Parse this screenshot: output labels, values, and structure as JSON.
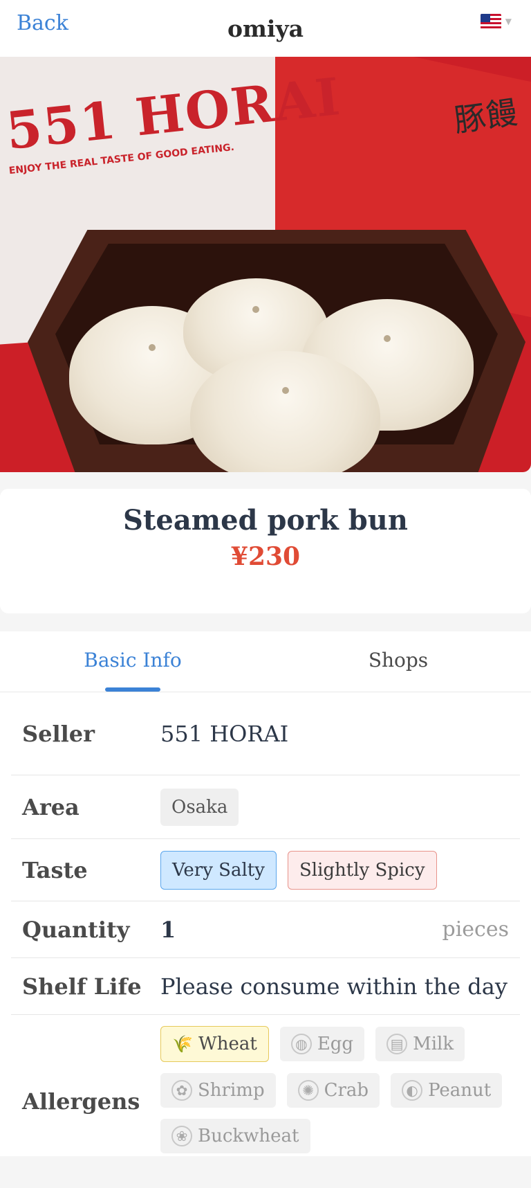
{
  "nav": {
    "back_label": "Back",
    "title": "omiya",
    "language_icon": "us-flag-icon"
  },
  "hero": {
    "brand_text": "551 HORAI",
    "brand_tagline": "ENJOY THE REAL TASTE OF GOOD EATING.",
    "box_kanji": "豚饅"
  },
  "product": {
    "name": "Steamed pork bun",
    "price": "¥230"
  },
  "tabs": [
    {
      "label": "Basic Info",
      "active": true
    },
    {
      "label": "Shops",
      "active": false
    }
  ],
  "details": {
    "seller": {
      "label": "Seller",
      "value": "551 HORAI"
    },
    "area": {
      "label": "Area",
      "value": "Osaka"
    },
    "taste": {
      "label": "Taste",
      "tags": [
        "Very Salty",
        "Slightly Spicy"
      ]
    },
    "quantity": {
      "label": "Quantity",
      "value": "1",
      "unit": "pieces"
    },
    "shelf_life": {
      "label": "Shelf Life",
      "value": "Please consume within the day"
    },
    "allergens": {
      "label": "Allergens",
      "items": [
        {
          "name": "Wheat",
          "icon": "wheat-icon",
          "active": true
        },
        {
          "name": "Egg",
          "icon": "egg-icon",
          "active": false
        },
        {
          "name": "Milk",
          "icon": "milk-icon",
          "active": false
        },
        {
          "name": "Shrimp",
          "icon": "shrimp-icon",
          "active": false
        },
        {
          "name": "Crab",
          "icon": "crab-icon",
          "active": false
        },
        {
          "name": "Peanut",
          "icon": "peanut-icon",
          "active": false
        },
        {
          "name": "Buckwheat",
          "icon": "buckwheat-icon",
          "active": false
        }
      ]
    }
  },
  "colors": {
    "accent": "#3b82d6",
    "price": "#e04b35"
  }
}
